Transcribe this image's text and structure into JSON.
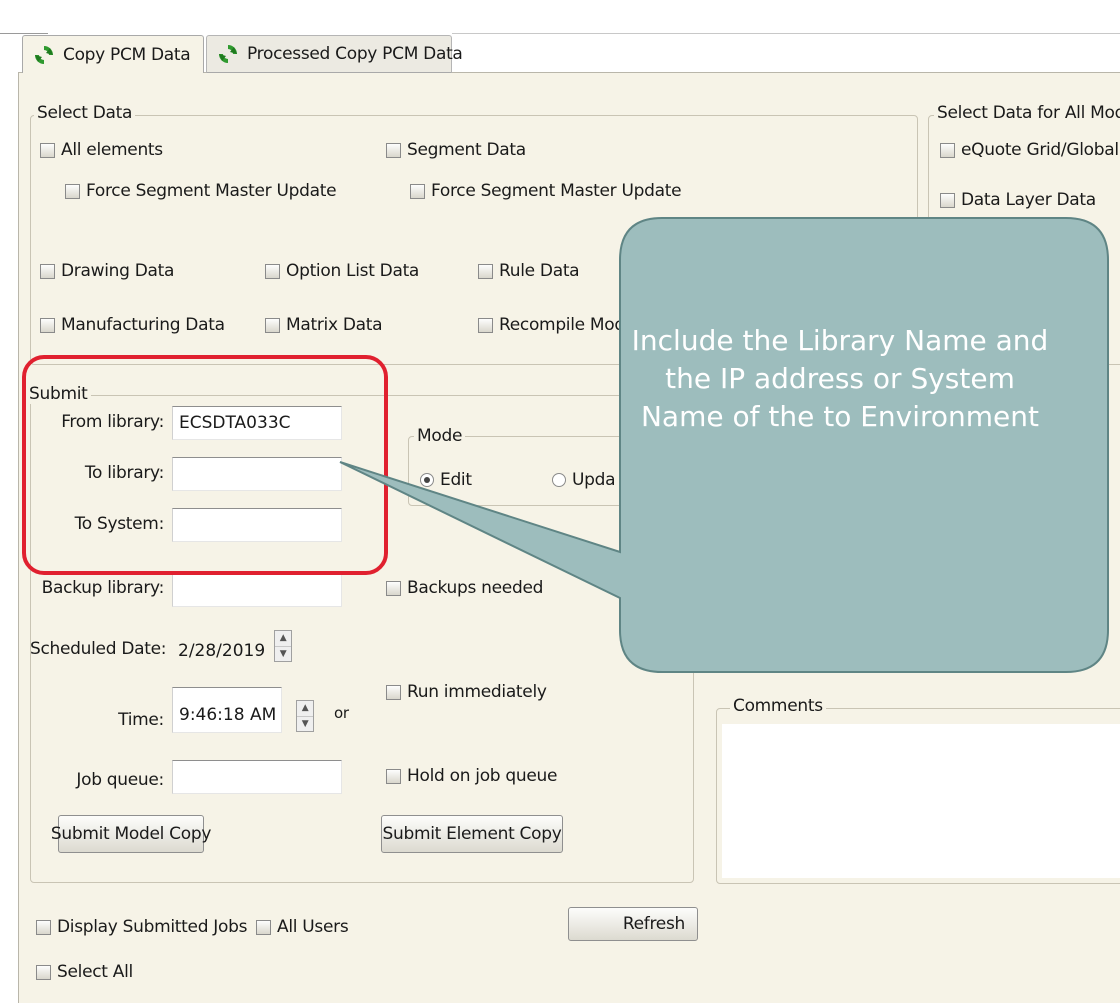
{
  "tabs": [
    {
      "label": "Copy PCM Data",
      "icon": "refresh-icon",
      "active": true
    },
    {
      "label": "Processed Copy PCM Data",
      "icon": "refresh-icon",
      "active": false
    }
  ],
  "select_data": {
    "legend": "Select Data",
    "all_elements": "All elements",
    "force_segment_master_update_1": "Force Segment Master Update",
    "segment_data": "Segment Data",
    "force_segment_master_update_2": "Force Segment Master Update",
    "drawing_data": "Drawing Data",
    "option_list_data": "Option List Data",
    "rule_data": "Rule Data",
    "manufacturing_data": "Manufacturing Data",
    "matrix_data": "Matrix Data",
    "recompile_models": "Recompile Mode"
  },
  "select_all_models": {
    "legend": "Select Data for All Models",
    "equote_grid_global": "eQuote Grid/Global",
    "data_layer_data": "Data Layer Data"
  },
  "submit": {
    "legend": "Submit",
    "from_library_label": "From library:",
    "from_library_value": "ECSDTA033C",
    "to_library_label": "To library:",
    "to_library_value": "",
    "to_system_label": "To System:",
    "to_system_value": "",
    "mode_legend": "Mode",
    "mode_edit": "Edit",
    "mode_update": "Upda",
    "backup_library_label": "Backup library:",
    "backup_library_value": "",
    "backups_needed": "Backups needed",
    "scheduled_date_label": "Scheduled Date:",
    "scheduled_date_value": "2/28/2019",
    "time_label": "Time:",
    "time_value": "9:46:18 AM",
    "or_label": "or",
    "run_immediately": "Run immediately",
    "job_queue_label": "Job queue:",
    "job_queue_value": "",
    "hold_on_job_queue": "Hold on job queue",
    "submit_model_copy": "Submit Model Copy",
    "submit_element_copy": "Submit Element Copy"
  },
  "comments": {
    "legend": "Comments",
    "value": ""
  },
  "bottom": {
    "display_submitted_jobs": "Display Submitted Jobs",
    "all_users": "All Users",
    "refresh": "Refresh",
    "select_all": "Select All"
  },
  "callout": {
    "text": "Include the Library Name  and the IP address or System Name of the to Environment"
  },
  "colors": {
    "highlight": "#e0202f",
    "callout_fill": "#9dbdbd",
    "panel_background": "#f6f3e7"
  }
}
